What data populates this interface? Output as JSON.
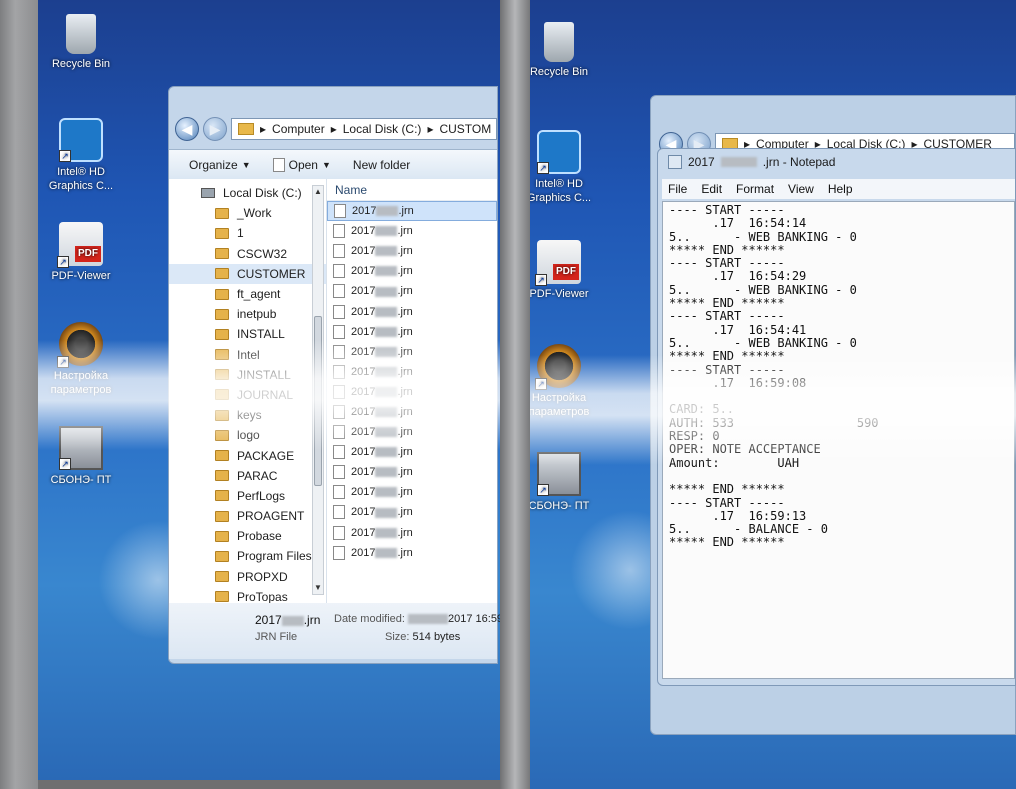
{
  "desktop": {
    "icons": [
      {
        "label": "Recycle Bin",
        "icon": "recycle-bin-icon"
      },
      {
        "label": "Intel® HD Graphics C...",
        "icon": "intel-graphics-icon"
      },
      {
        "label": "PDF-Viewer",
        "icon": "pdf-viewer-icon"
      },
      {
        "label": "Настройка параметров",
        "icon": "settings-gear-icon"
      },
      {
        "label": "СБОНЭ- ПТ",
        "icon": "computer-icon"
      }
    ]
  },
  "explorer": {
    "address": [
      "Computer",
      "Local Disk (C:)",
      "CUSTOM"
    ],
    "toolbar": {
      "organize": "Organize",
      "open": "Open",
      "new_folder": "New folder"
    },
    "nav_items": [
      {
        "label": "Local Disk (C:)",
        "kind": "drive"
      },
      {
        "label": "_Work"
      },
      {
        "label": "1"
      },
      {
        "label": "CSCW32"
      },
      {
        "label": "CUSTOMER",
        "selected": true
      },
      {
        "label": "ft_agent"
      },
      {
        "label": "inetpub"
      },
      {
        "label": "INSTALL"
      },
      {
        "label": "Intel"
      },
      {
        "label": "JINSTALL"
      },
      {
        "label": "JOURNAL"
      },
      {
        "label": "keys"
      },
      {
        "label": "logo"
      },
      {
        "label": "PACKAGE"
      },
      {
        "label": "PARAC"
      },
      {
        "label": "PerfLogs"
      },
      {
        "label": "PROAGENT"
      },
      {
        "label": "Probase"
      },
      {
        "label": "Program Files"
      },
      {
        "label": "PROPXD"
      },
      {
        "label": "ProTopas"
      }
    ],
    "column_name": "Name",
    "file_prefix": "2017",
    "file_ext": ".jrn",
    "file_count": 18,
    "details": {
      "name": ".jrn",
      "name_prefix": "2017",
      "type": "JRN File",
      "modified_label": "Date modified:",
      "modified_value": "2017 16:59",
      "size_label": "Size:",
      "size_value": "514 bytes"
    }
  },
  "notepad": {
    "bg_address": [
      "Computer",
      "Local Disk (C:)",
      "CUSTOMER"
    ],
    "title_prefix": "2017",
    "title_suffix": ".jrn - Notepad",
    "menu": [
      "File",
      "Edit",
      "Format",
      "View",
      "Help"
    ],
    "lines": [
      "---- START -----",
      "      .17  16:54:14",
      "5..      - WEB BANKING - 0",
      "***** END ******",
      "---- START -----",
      "      .17  16:54:29",
      "5..      - WEB BANKING - 0",
      "***** END ******",
      "---- START -----",
      "      .17  16:54:41",
      "5..      - WEB BANKING - 0",
      "***** END ******",
      "---- START -----",
      "      .17  16:59:08",
      "",
      "CARD: 5..",
      "AUTH: 533                 590",
      "RESP: 0",
      "OPER: NOTE ACCEPTANCE",
      "Amount:        UAH",
      "",
      "***** END ******",
      "---- START -----",
      "      .17  16:59:13",
      "5..      - BALANCE - 0",
      "***** END ******"
    ]
  }
}
